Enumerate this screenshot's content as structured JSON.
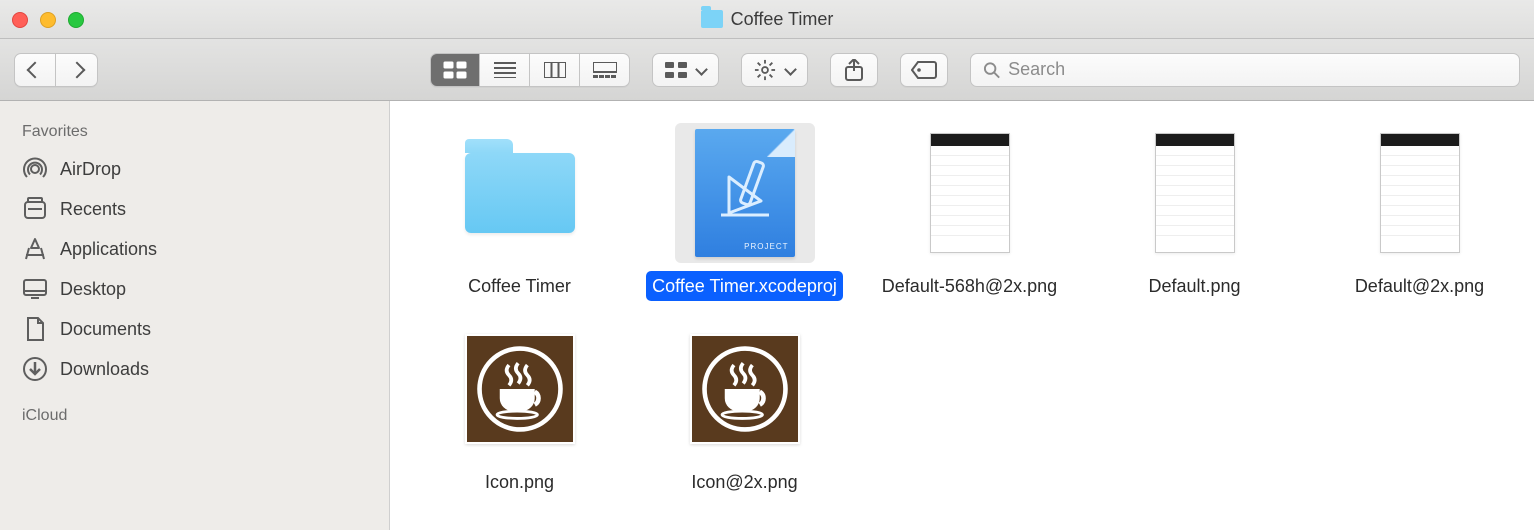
{
  "window": {
    "title": "Coffee Timer"
  },
  "toolbar": {
    "search_placeholder": "Search"
  },
  "sidebar": {
    "sections": [
      {
        "header": "Favorites",
        "items": [
          {
            "icon": "airdrop",
            "label": "AirDrop"
          },
          {
            "icon": "recents",
            "label": "Recents"
          },
          {
            "icon": "applications",
            "label": "Applications"
          },
          {
            "icon": "desktop",
            "label": "Desktop"
          },
          {
            "icon": "documents",
            "label": "Documents"
          },
          {
            "icon": "downloads",
            "label": "Downloads"
          }
        ]
      },
      {
        "header": "iCloud",
        "items": []
      }
    ]
  },
  "files": [
    {
      "name": "Coffee Timer",
      "kind": "folder",
      "selected": false
    },
    {
      "name": "Coffee Timer.xcodeproj",
      "kind": "xcode",
      "selected": true
    },
    {
      "name": "Default-568h@2x.png",
      "kind": "png",
      "selected": false
    },
    {
      "name": "Default.png",
      "kind": "png",
      "selected": false
    },
    {
      "name": "Default@2x.png",
      "kind": "png",
      "selected": false
    },
    {
      "name": "Icon.png",
      "kind": "coffee",
      "selected": false
    },
    {
      "name": "Icon@2x.png",
      "kind": "coffee",
      "selected": false
    }
  ]
}
